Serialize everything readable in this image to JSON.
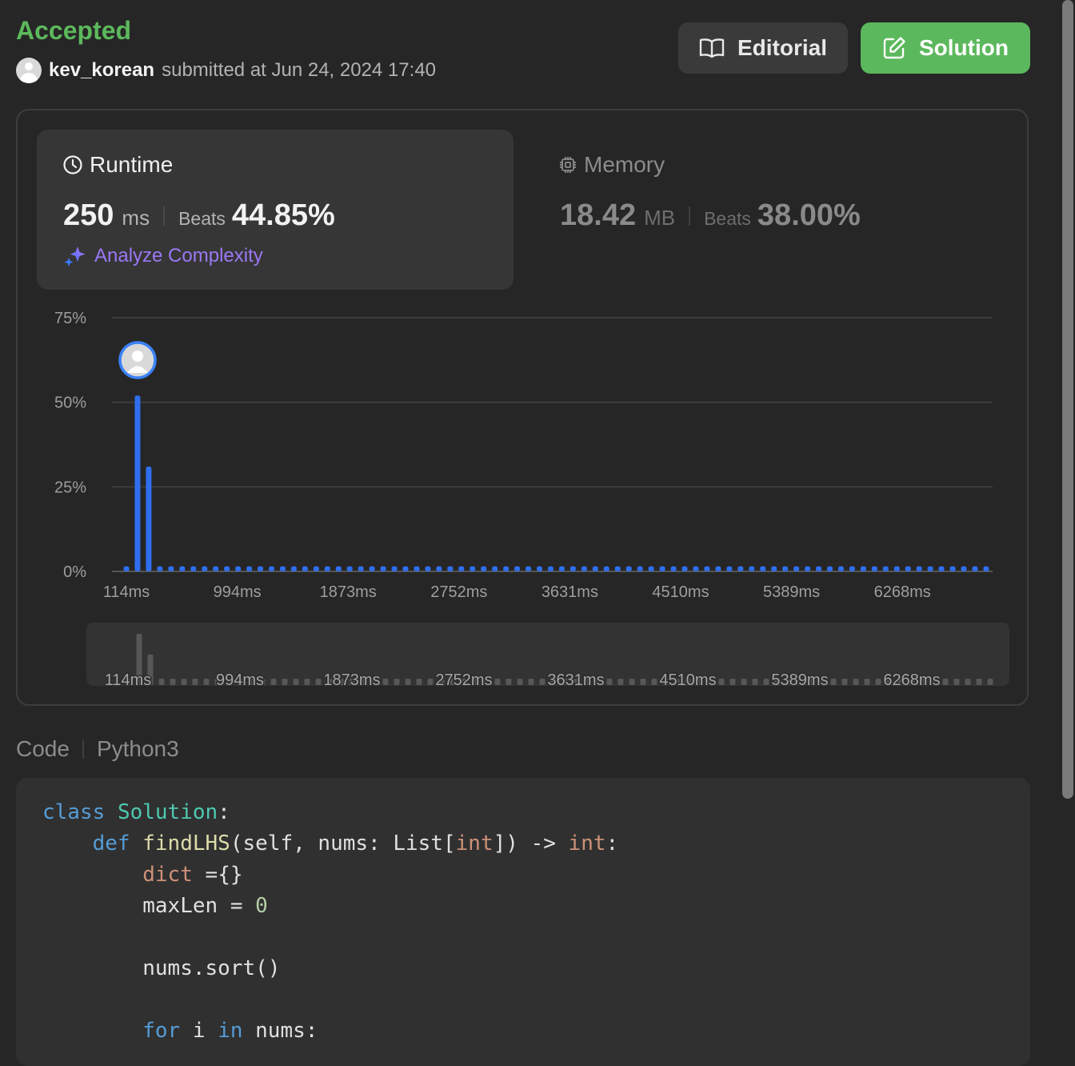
{
  "submission": {
    "status": "Accepted",
    "username": "kev_korean",
    "submitted_text": "submitted at Jun 24, 2024 17:40",
    "status_color": "#5cb85c"
  },
  "buttons": {
    "editorial": "Editorial",
    "solution": "Solution"
  },
  "runtime": {
    "title": "Runtime",
    "value": "250",
    "unit": "ms",
    "beats_label": "Beats",
    "beats_value": "44.85%"
  },
  "memory": {
    "title": "Memory",
    "value": "18.42",
    "unit": "MB",
    "beats_label": "Beats",
    "beats_value": "38.00%"
  },
  "analyze_label": "Analyze Complexity",
  "icons": {
    "editorial": "book-icon",
    "solution": "edit-icon",
    "runtime": "clock-icon",
    "memory": "chip-icon",
    "analyze": "sparkle-icon"
  },
  "colors": {
    "accent_green": "#5cb85c",
    "bar_blue": "#2f6fed",
    "analyze_purple": "#9b78f5"
  },
  "chart_data": {
    "type": "bar",
    "title": "",
    "xlabel": "",
    "ylabel": "",
    "ylim": [
      0,
      75
    ],
    "y_ticks": [
      "0%",
      "25%",
      "50%",
      "75%"
    ],
    "x_tick_labels": [
      "114ms",
      "994ms",
      "1873ms",
      "2752ms",
      "3631ms",
      "4510ms",
      "5389ms",
      "6268ms"
    ],
    "user_bin": "250ms",
    "series": [
      {
        "values": [
          1.5,
          52.0,
          31.0,
          1.5,
          1.5,
          1.5,
          1.5,
          1.5,
          1.5,
          1.5,
          1.5,
          1.5,
          1.5,
          1.5,
          1.5,
          1.5,
          1.5,
          1.5,
          1.5,
          1.5,
          1.5,
          1.5,
          1.5,
          1.5,
          1.5,
          1.5,
          1.5,
          1.5,
          1.5,
          1.5,
          1.5,
          1.5,
          1.5,
          1.5,
          1.5,
          1.5,
          1.5,
          1.5,
          1.5,
          1.5,
          1.5,
          1.5,
          1.5,
          1.5,
          1.5,
          1.5,
          1.5,
          1.5,
          1.5,
          1.5,
          1.5,
          1.5,
          1.5,
          1.5,
          1.5,
          1.5,
          1.5,
          1.5,
          1.5,
          1.5,
          1.5,
          1.5,
          1.5,
          1.5,
          1.5,
          1.5,
          1.5,
          1.5,
          1.5,
          1.5,
          1.5,
          1.5,
          1.5,
          1.5,
          1.5,
          1.5,
          1.5,
          1.5
        ]
      }
    ],
    "grid": true
  },
  "code_header": {
    "label": "Code",
    "language": "Python3"
  },
  "code_lines": [
    "class Solution:",
    "    def findLHS(self, nums: List[int]) -> int:",
    "        dict ={}",
    "        maxLen = 0",
    "",
    "        nums.sort()",
    "",
    "        for i in nums:"
  ]
}
